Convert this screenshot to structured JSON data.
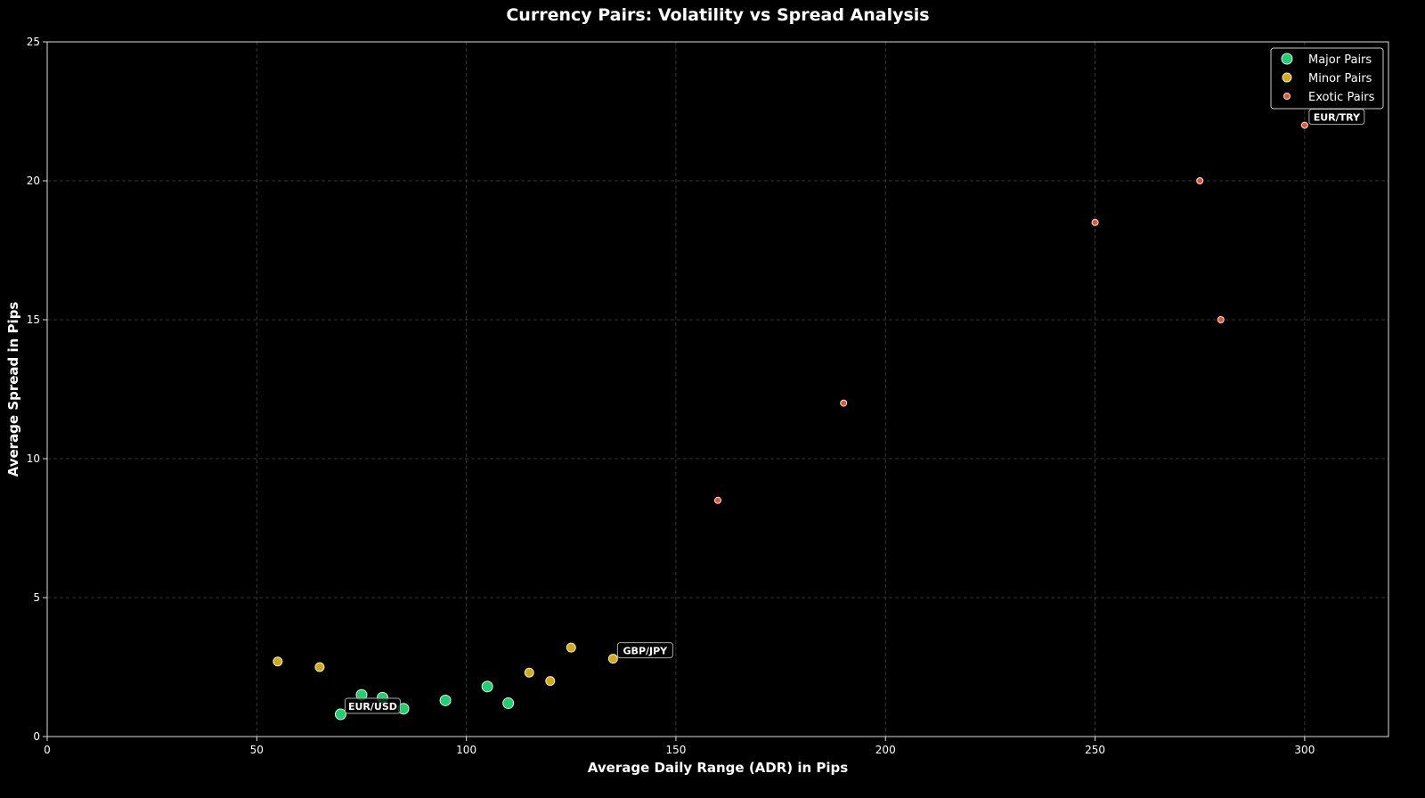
{
  "chart_data": {
    "type": "scatter",
    "title": "Currency Pairs: Volatility vs Spread Analysis",
    "xlabel": "Average Daily Range (ADR) in Pips",
    "ylabel": "Average Spread in Pips",
    "xlim": [
      0,
      320
    ],
    "ylim": [
      0,
      25
    ],
    "xticks": [
      0,
      50,
      100,
      150,
      200,
      250,
      300
    ],
    "yticks": [
      0,
      5,
      10,
      15,
      20,
      25
    ],
    "grid": true,
    "legend_position": "top-right",
    "series": [
      {
        "name": "Major Pairs",
        "color": "#1ed16f",
        "x": [
          70,
          75,
          80,
          85,
          95,
          105,
          110
        ],
        "y": [
          0.8,
          1.5,
          1.4,
          1.0,
          1.3,
          1.8,
          1.2
        ]
      },
      {
        "name": "Minor Pairs",
        "color": "#d4ac0d",
        "x": [
          55,
          65,
          115,
          120,
          125,
          135
        ],
        "y": [
          2.7,
          2.5,
          2.3,
          2.0,
          3.2,
          2.8
        ]
      },
      {
        "name": "Exotic Pairs",
        "color": "#f0512a",
        "x": [
          160,
          190,
          250,
          275,
          280,
          300
        ],
        "y": [
          8.5,
          12.0,
          18.5,
          20.0,
          15.0,
          22.0
        ]
      }
    ],
    "annotations": [
      {
        "text": "EUR/USD",
        "x": 70,
        "y": 0.8
      },
      {
        "text": "GBP/JPY",
        "x": 135,
        "y": 2.8
      },
      {
        "text": "EUR/TRY",
        "x": 300,
        "y": 22.0
      }
    ]
  }
}
